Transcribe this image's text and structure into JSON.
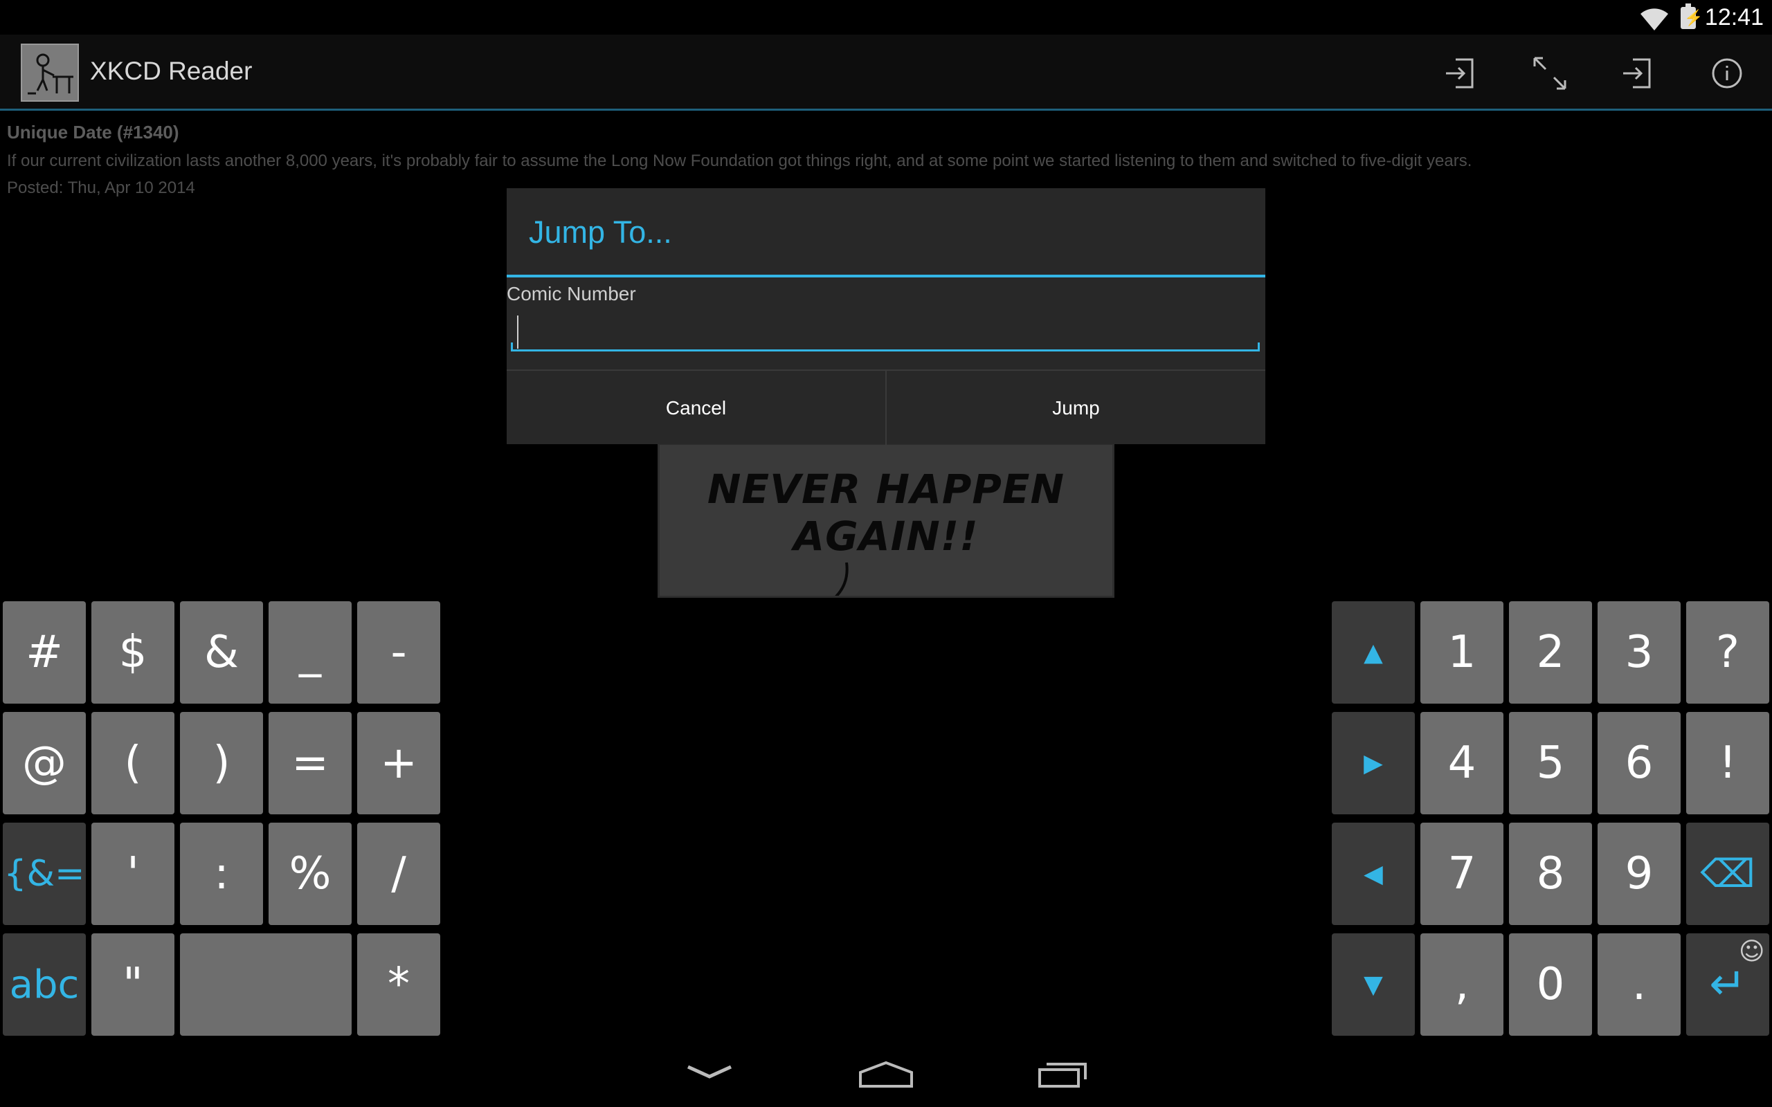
{
  "status_bar": {
    "time": "12:41",
    "battery_glyph": "⚡",
    "icons": [
      "wifi-icon",
      "battery-icon"
    ]
  },
  "action_bar": {
    "title": "XKCD Reader",
    "icons": [
      "app-icon",
      "first-comic-icon",
      "fullscreen-icon",
      "last-comic-icon",
      "info-icon"
    ]
  },
  "comic": {
    "title": "Unique Date (#1340)",
    "alt_text": "If our current civilization lasts another 8,000 years, it's probably fair to assume the Long Now Foundation got things right, and at some point we started listening to them and switched to five-digit years.",
    "posted": "Posted: Thu, Apr 10 2014",
    "panel_lines": [
      "NEVER HAPPEN",
      "AGAIN!!"
    ]
  },
  "dialog": {
    "title": "Jump To...",
    "field_label": "Comic Number",
    "field_value": "",
    "cancel_label": "Cancel",
    "jump_label": "Jump"
  },
  "keyboard": {
    "left_keys": [
      [
        "#",
        "$",
        "&",
        "_",
        "-"
      ],
      [
        "@",
        "(",
        ")",
        "=",
        "+"
      ],
      [
        "{&=",
        "'",
        ":",
        "%",
        "/"
      ],
      [
        "abc",
        "\"",
        "",
        "*"
      ]
    ],
    "right_keys": [
      [
        "▲",
        "1",
        "2",
        "3",
        "?"
      ],
      [
        "▶",
        "4",
        "5",
        "6",
        "!"
      ],
      [
        "◀",
        "7",
        "8",
        "9",
        "⌫"
      ],
      [
        "▼",
        ",",
        "0",
        ".",
        "↵"
      ]
    ],
    "emoji_glyph": "☺",
    "accent_color": "#33b5e5"
  },
  "nav_bar": {
    "icons": [
      "back-icon",
      "home-icon",
      "recent-apps-icon"
    ]
  }
}
